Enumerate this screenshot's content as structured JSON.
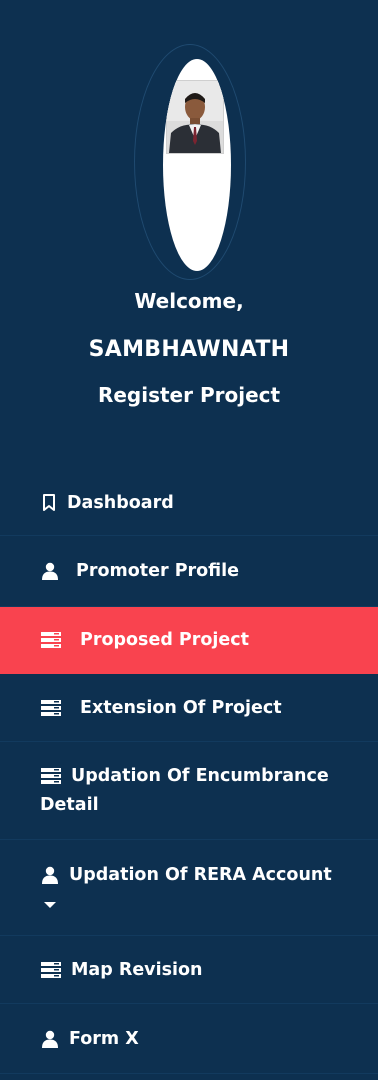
{
  "profile": {
    "greeting": "Welcome,",
    "user_name": "SAMBHAWNATH",
    "role": "Register Project"
  },
  "menu": {
    "items": [
      {
        "label": "Dashboard",
        "icon": "bookmark-icon"
      },
      {
        "label": "Promoter Profile",
        "icon": "user-icon"
      },
      {
        "label": "Proposed Project",
        "icon": "list-icon",
        "active": true
      },
      {
        "label": "Extension Of Project",
        "icon": "list-icon"
      },
      {
        "label": "Updation Of Encumbrance",
        "label2": "Detail",
        "icon": "list-icon"
      },
      {
        "label": "Updation Of RERA Account",
        "icon": "user-icon",
        "has_dropdown": true
      },
      {
        "label": "Map Revision",
        "icon": "list-icon"
      },
      {
        "label": "Form X",
        "icon": "user-icon"
      }
    ]
  },
  "colors": {
    "sidebar_bg": "#0d3050",
    "active_bg": "#f9434f",
    "text": "#ffffff"
  }
}
